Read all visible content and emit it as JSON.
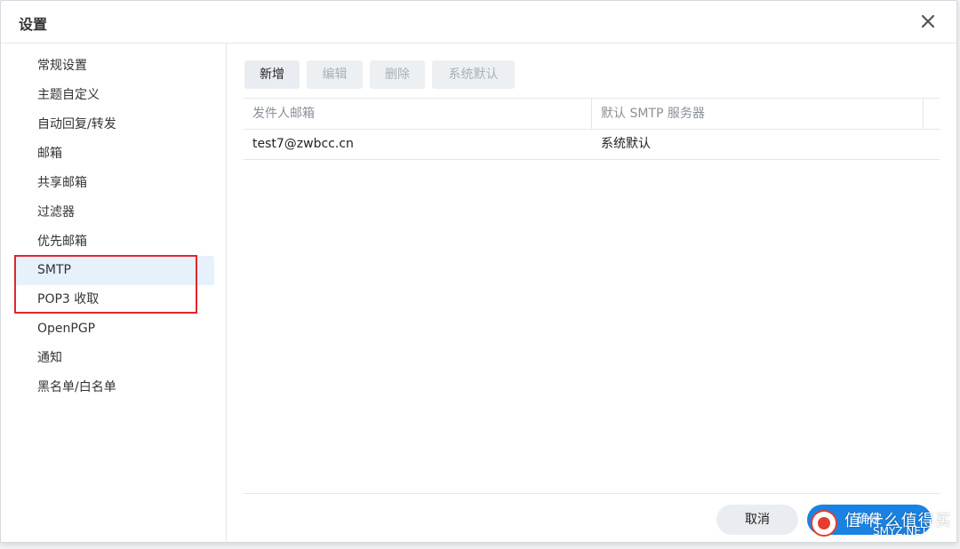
{
  "dialog": {
    "title": "设置",
    "close_icon": "close-icon"
  },
  "sidebar": {
    "items": [
      {
        "label": "常规设置"
      },
      {
        "label": "主题自定义"
      },
      {
        "label": "自动回复/转发"
      },
      {
        "label": "邮箱"
      },
      {
        "label": "共享邮箱"
      },
      {
        "label": "过滤器"
      },
      {
        "label": "优先邮箱"
      },
      {
        "label": "SMTP",
        "selected": true
      },
      {
        "label": "POP3 收取"
      },
      {
        "label": "OpenPGP"
      },
      {
        "label": "通知"
      },
      {
        "label": "黑名单/白名单"
      }
    ]
  },
  "toolbar": {
    "add_label": "新增",
    "edit_label": "编辑",
    "delete_label": "删除",
    "system_default_label": "系统默认"
  },
  "table": {
    "columns": [
      "发件人邮箱",
      "默认 SMTP 服务器"
    ],
    "rows": [
      [
        "test7@zwbcc.cn",
        "系统默认"
      ]
    ]
  },
  "footer": {
    "cancel_label": "取消",
    "ok_label": "确定"
  },
  "watermark": {
    "text": "值 什么值得买",
    "sub": "SMYZ.NET"
  },
  "colors": {
    "accent": "#1a82e2",
    "selected_bg": "#e6f1fb",
    "highlight_border": "#e0262f"
  }
}
